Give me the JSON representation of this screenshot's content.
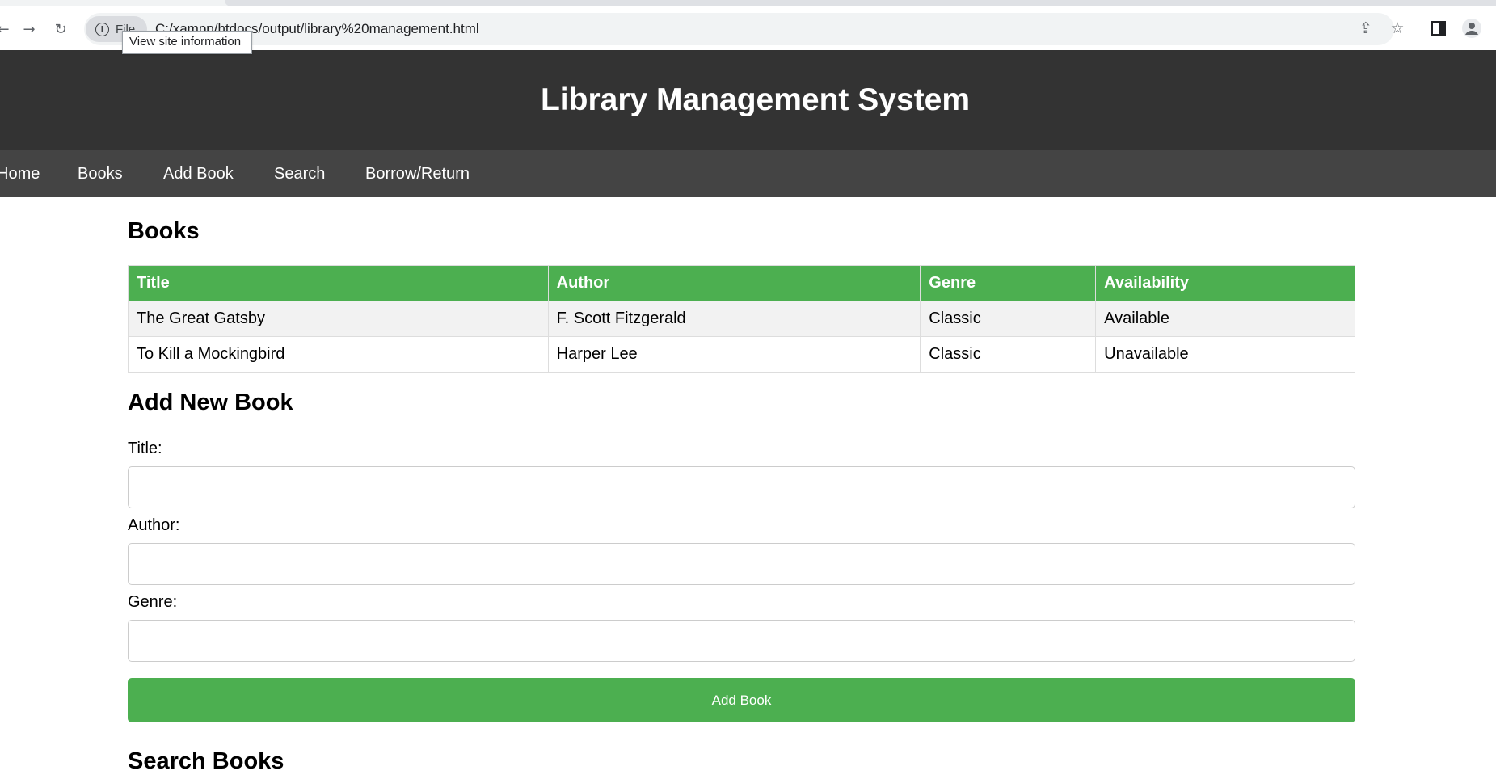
{
  "browser": {
    "site_chip_label": "File",
    "url": "C:/xampp/htdocs/output/library%20management.html",
    "tooltip": "View site information"
  },
  "header": {
    "title": "Library Management System"
  },
  "nav": {
    "items": [
      "Home",
      "Books",
      "Add Book",
      "Search",
      "Borrow/Return"
    ]
  },
  "books": {
    "heading": "Books",
    "columns": [
      "Title",
      "Author",
      "Genre",
      "Availability"
    ],
    "rows": [
      [
        "The Great Gatsby",
        "F. Scott Fitzgerald",
        "Classic",
        "Available"
      ],
      [
        "To Kill a Mockingbird",
        "Harper Lee",
        "Classic",
        "Unavailable"
      ]
    ]
  },
  "add_book": {
    "heading": "Add New Book",
    "title_label": "Title:",
    "title_value": "",
    "author_label": "Author:",
    "author_value": "",
    "genre_label": "Genre:",
    "genre_value": "",
    "submit_label": "Add Book"
  },
  "search": {
    "heading": "Search Books"
  },
  "colors": {
    "header_bg": "#333333",
    "nav_bg": "#444444",
    "accent": "#4caf50"
  }
}
